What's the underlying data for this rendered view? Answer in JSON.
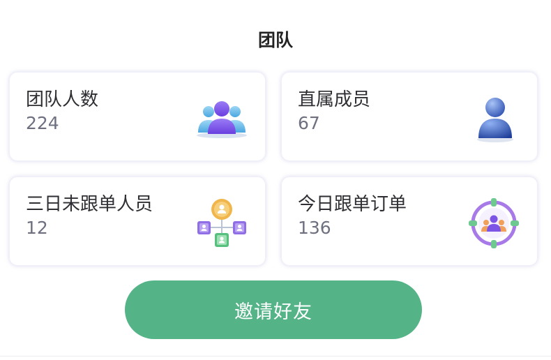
{
  "header": {
    "title": "团队"
  },
  "cards": [
    {
      "label": "团队人数",
      "value": "224",
      "icon": "team-members-icon"
    },
    {
      "label": "直属成员",
      "value": "67",
      "icon": "direct-member-icon"
    },
    {
      "label": "三日未跟单人员",
      "value": "12",
      "icon": "network-members-icon"
    },
    {
      "label": "今日跟单订单",
      "value": "136",
      "icon": "target-team-icon"
    }
  ],
  "invite_button": {
    "label": "邀请好友",
    "color": "#55b487"
  }
}
